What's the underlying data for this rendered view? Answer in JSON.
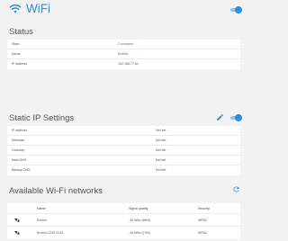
{
  "header": {
    "title": "WiFi",
    "wifi_enabled": true
  },
  "status": {
    "title": "Status",
    "rows": [
      {
        "label": "State",
        "value": "Connected"
      },
      {
        "label": "Name",
        "value": "Enxhin"
      },
      {
        "label": "IP address",
        "value": "192.168.77.61"
      }
    ]
  },
  "static_ip": {
    "title": "Static IP Settings",
    "enabled": true,
    "rows": [
      {
        "label": "IP address",
        "value": "Not set"
      },
      {
        "label": "Netmask",
        "value": "Not set"
      },
      {
        "label": "Gateway",
        "value": "Not set"
      },
      {
        "label": "Main DNS",
        "value": "Not set"
      },
      {
        "label": "Backup DNS",
        "value": "Not set"
      }
    ]
  },
  "networks": {
    "title": "Available Wi-Fi networks",
    "columns": {
      "name": "Name",
      "signal": "Signal quality",
      "security": "Security"
    },
    "rows": [
      {
        "name": "Enxhin",
        "signal": "-45 dBm (86%)",
        "security": "WPA2",
        "icon": "wifi-locked-icon"
      },
      {
        "name": "Enxhin-2230-9132",
        "signal": "-49 dBm (73%)",
        "security": "WPA2",
        "icon": "wifi-locked-icon"
      }
    ]
  },
  "colors": {
    "accent": "#2a8fd8",
    "connected": "#2e9e46"
  }
}
